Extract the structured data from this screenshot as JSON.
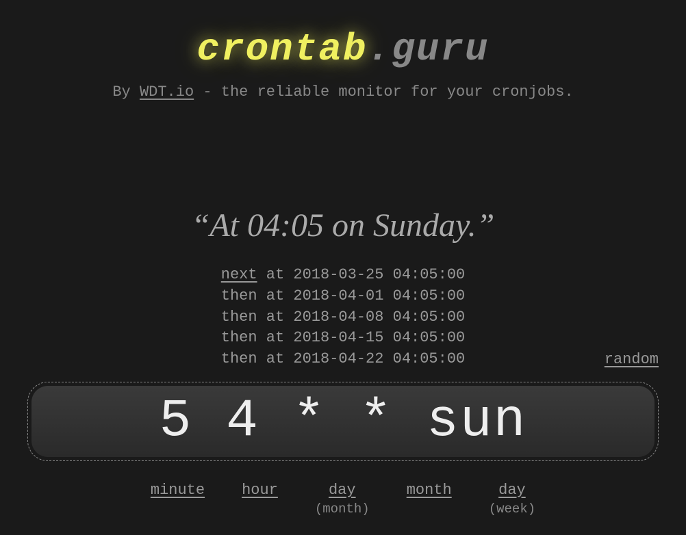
{
  "header": {
    "logo_crontab": "crontab",
    "logo_dot": ".",
    "logo_guru": "guru",
    "tagline_prefix": "By ",
    "tagline_link": "WDT.io",
    "tagline_suffix": " - the reliable monitor for your cronjobs."
  },
  "description": "“At 04:05 on Sunday.”",
  "schedule": {
    "lines": [
      {
        "label": "next",
        "text": " at 2018-03-25 04:05:00",
        "link": true
      },
      {
        "label": "then",
        "text": " at 2018-04-01 04:05:00",
        "link": false
      },
      {
        "label": "then",
        "text": " at 2018-04-08 04:05:00",
        "link": false
      },
      {
        "label": "then",
        "text": " at 2018-04-15 04:05:00",
        "link": false
      },
      {
        "label": "then",
        "text": " at 2018-04-22 04:05:00",
        "link": false
      }
    ]
  },
  "random_label": "random",
  "cron_expression": "5 4 * * sun",
  "fields": [
    {
      "main": "minute",
      "sub": ""
    },
    {
      "main": "hour",
      "sub": ""
    },
    {
      "main": "day",
      "sub": "(month)"
    },
    {
      "main": "month",
      "sub": ""
    },
    {
      "main": "day",
      "sub": "(week)"
    }
  ]
}
